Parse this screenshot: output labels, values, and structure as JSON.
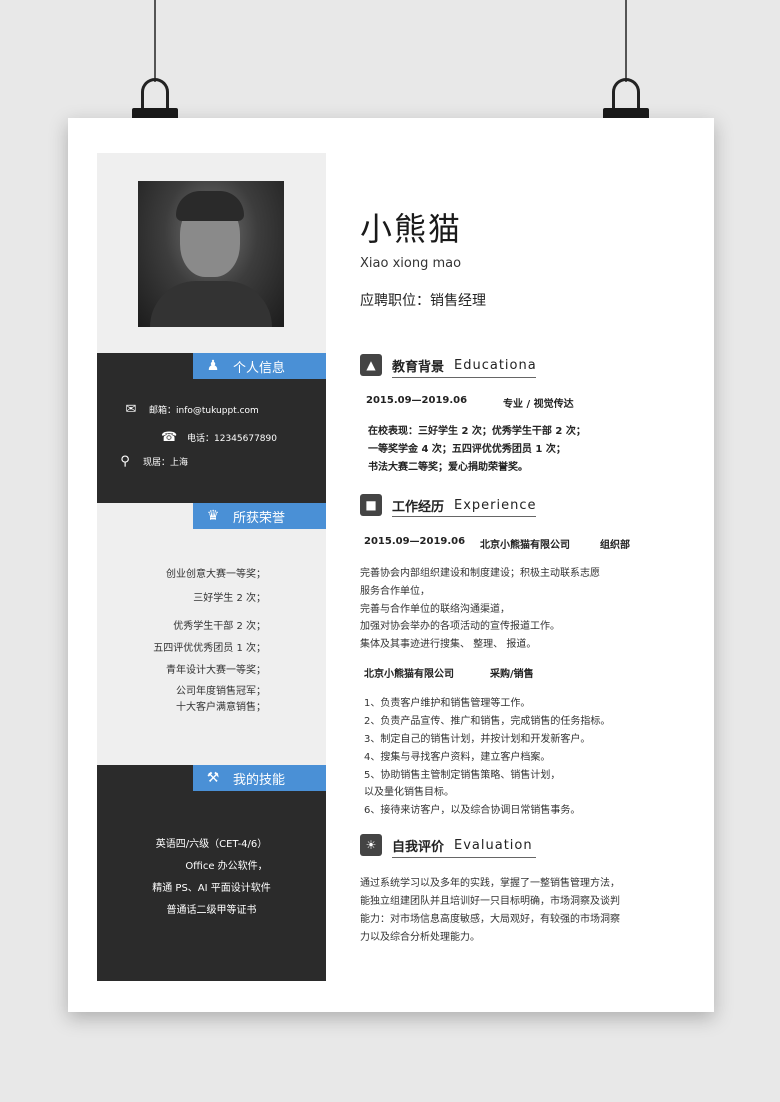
{
  "name": "小熊猫",
  "pinyin": "Xiao xiong mao",
  "position": "应聘职位：销售经理",
  "personal": {
    "title": "个人信息",
    "email": "邮箱：info@tukuppt.com",
    "phone": "电话：12345677890",
    "address": "现居：上海"
  },
  "awards": {
    "title": "所获荣誉",
    "items": [
      "创业创意大赛一等奖；",
      "三好学生 2 次；",
      "优秀学生干部 2 次；",
      "五四评优优秀团员 1 次；",
      "青年设计大赛一等奖；",
      "公司年度销售冠军；",
      "十大客户满意销售；"
    ]
  },
  "skills": {
    "title": "我的技能",
    "items": [
      "英语四/六级（CET-4/6）",
      "Office 办公软件，",
      "精通 PS、AI 平面设计软件",
      "普通话二级甲等证书"
    ]
  },
  "education": {
    "title": "教育背景",
    "title_en": "Educationa",
    "period": "2015.09—2019.06",
    "major": "专业 / 视觉传达",
    "lines": [
      "在校表现：三好学生 2 次；优秀学生干部 2 次；",
      "一等奖学金 4 次；五四评优优秀团员 1 次；",
      "书法大赛二等奖；爱心捐助荣誉奖。"
    ]
  },
  "work": {
    "title": "工作经历",
    "title_en": "Experience",
    "period": "2015.09—2019.06",
    "company": "北京小熊猫有限公司",
    "dept": "组织部",
    "duties": [
      "完善协会内部组织建设和制度建设；积极主动联系志愿",
      "服务合作单位，",
      "完善与合作单位的联络沟通渠道，",
      "加强对协会举办的各项活动的宣传报道工作。",
      "集体及其事迹进行搜集、 整理、 报道。"
    ],
    "company2": "北京小熊猫有限公司",
    "role2": "采购/销售",
    "tasks": [
      "1、负责客户维护和销售管理等工作。",
      "2、负责产品宣传、推广和销售，完成销售的任务指标。",
      "3、制定自己的销售计划，并按计划和开发新客户。",
      "4、搜集与寻找客户资料，建立客户档案。",
      "5、协助销售主管制定销售策略、销售计划，",
      "以及量化销售目标。",
      "6、接待来访客户，以及综合协调日常销售事务。"
    ]
  },
  "evaluation": {
    "title": "自我评价",
    "title_en": "Evaluation",
    "lines": [
      "通过系统学习以及多年的实践，掌握了一整销售管理方法，",
      "能独立组建团队并且培训好一只目标明确，市场洞察及谈判",
      "能力：对市场信息高度敏感，大局观好，有较强的市场洞察",
      "力以及综合分析处理能力。"
    ]
  },
  "colors": {
    "accent": "#4a90d6",
    "dark": "#2b2b2b",
    "sidebar": "#efefef"
  }
}
